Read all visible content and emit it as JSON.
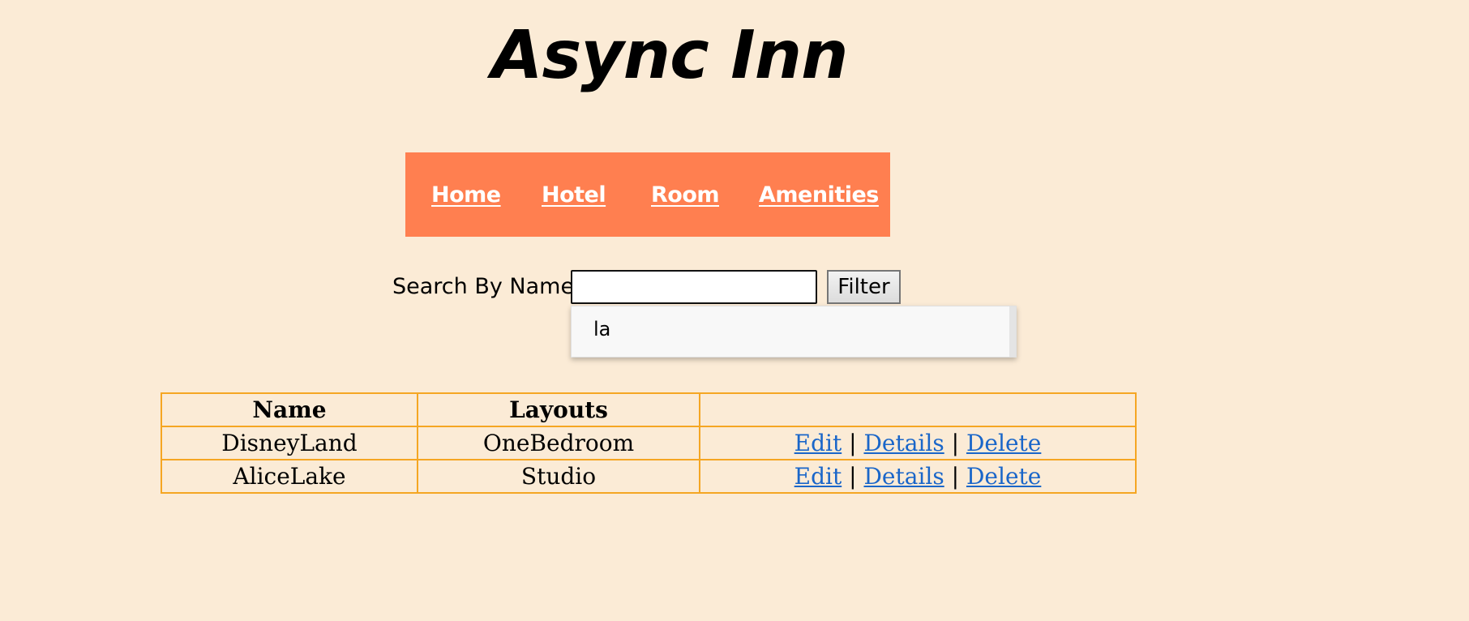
{
  "header": {
    "title": "Async Inn"
  },
  "nav": {
    "items": [
      {
        "label": "Home"
      },
      {
        "label": "Hotel"
      },
      {
        "label": "Room"
      },
      {
        "label": "Amenities"
      }
    ]
  },
  "search": {
    "label": "Search By Name:",
    "value": "",
    "button_label": "Filter",
    "autocomplete_suggestion": "la"
  },
  "table": {
    "headers": [
      "Name",
      "Layouts",
      ""
    ],
    "separator": "|",
    "rows": [
      {
        "name": "DisneyLand",
        "layout": "OneBedroom",
        "actions": {
          "edit": "Edit",
          "details": "Details",
          "delete": "Delete"
        }
      },
      {
        "name": "AliceLake",
        "layout": "Studio",
        "actions": {
          "edit": "Edit",
          "details": "Details",
          "delete": "Delete"
        }
      }
    ]
  },
  "colors": {
    "background": "#FBEBD6",
    "nav_background": "#FF7F50",
    "table_border": "#F5A623",
    "link": "#1a66c9"
  }
}
